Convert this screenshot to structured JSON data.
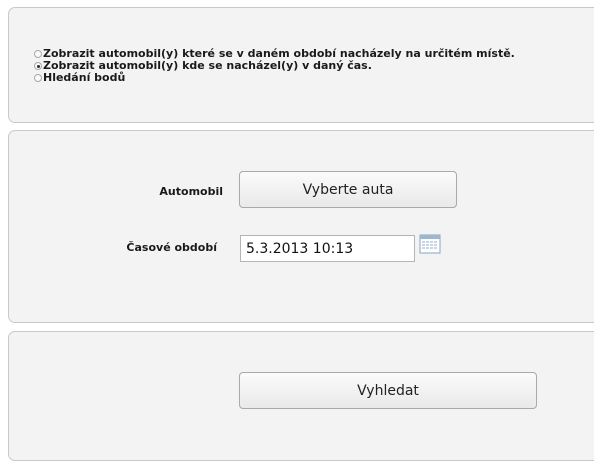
{
  "mode_options": [
    {
      "label": "Zobrazit automobil(y) které se v daném období nacházely na určitém místě.",
      "checked": false
    },
    {
      "label": "Zobrazit automobil(y) kde se nacházel(y) v daný čas.",
      "checked": true
    },
    {
      "label": "Hledání bodů",
      "checked": false
    }
  ],
  "filter": {
    "car_label": "Automobil",
    "car_button": "Vyberte auta",
    "period_label": "Časové období",
    "period_value": "5.3.2013 10:13"
  },
  "action": {
    "search_button": "Vyhledat"
  },
  "icons": {
    "calendar": "calendar-icon"
  },
  "colors": {
    "panel_bg": "#f3f3f3",
    "panel_border": "#c9c9c9"
  }
}
